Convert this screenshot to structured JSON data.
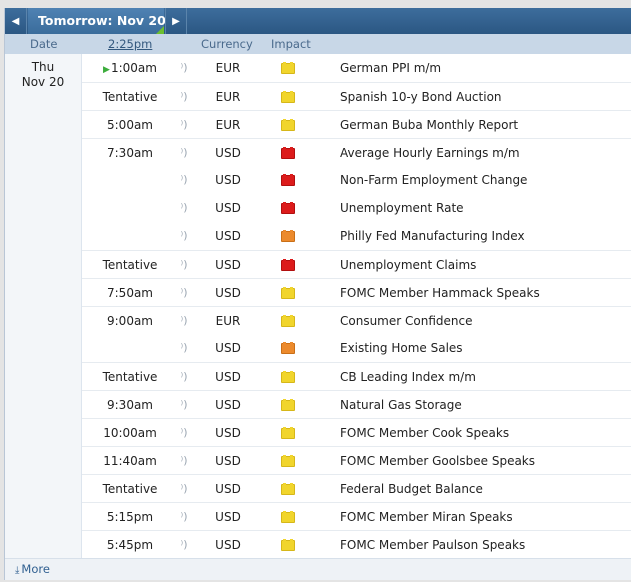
{
  "nav": {
    "prev_icon": "◀",
    "title": "Tomorrow: Nov 20",
    "next_icon": "▶"
  },
  "columns": {
    "date": "Date",
    "time": "2:25pm",
    "currency": "Currency",
    "impact": "Impact"
  },
  "date": {
    "weekday": "Thu",
    "day": "Nov 20"
  },
  "impact_colors": {
    "low": "#f1d52c",
    "medium": "#ec8a2c",
    "high": "#dc1b1b"
  },
  "events": [
    {
      "time": "1:00am",
      "next": true,
      "currency": "EUR",
      "impact": "low",
      "event": "German PPI m/m",
      "group_start": true
    },
    {
      "time": "Tentative",
      "currency": "EUR",
      "impact": "low",
      "event": "Spanish 10-y Bond Auction",
      "group_start": true
    },
    {
      "time": "5:00am",
      "currency": "EUR",
      "impact": "low",
      "event": "German Buba Monthly Report",
      "group_start": true
    },
    {
      "time": "7:30am",
      "currency": "USD",
      "impact": "high",
      "event": "Average Hourly Earnings m/m",
      "group_start": true
    },
    {
      "time": "",
      "currency": "USD",
      "impact": "high",
      "event": "Non-Farm Employment Change",
      "group_start": false
    },
    {
      "time": "",
      "currency": "USD",
      "impact": "high",
      "event": "Unemployment Rate",
      "group_start": false
    },
    {
      "time": "",
      "currency": "USD",
      "impact": "medium",
      "event": "Philly Fed Manufacturing Index",
      "group_start": false
    },
    {
      "time": "Tentative",
      "currency": "USD",
      "impact": "high",
      "event": "Unemployment Claims",
      "group_start": true
    },
    {
      "time": "7:50am",
      "currency": "USD",
      "impact": "low",
      "event": "FOMC Member Hammack Speaks",
      "group_start": true
    },
    {
      "time": "9:00am",
      "currency": "EUR",
      "impact": "low",
      "event": "Consumer Confidence",
      "group_start": true
    },
    {
      "time": "",
      "currency": "USD",
      "impact": "medium",
      "event": "Existing Home Sales",
      "group_start": false
    },
    {
      "time": "Tentative",
      "currency": "USD",
      "impact": "low",
      "event": "CB Leading Index m/m",
      "group_start": true
    },
    {
      "time": "9:30am",
      "currency": "USD",
      "impact": "low",
      "event": "Natural Gas Storage",
      "group_start": true
    },
    {
      "time": "10:00am",
      "currency": "USD",
      "impact": "low",
      "event": "FOMC Member Cook Speaks",
      "group_start": true
    },
    {
      "time": "11:40am",
      "currency": "USD",
      "impact": "low",
      "event": "FOMC Member Goolsbee Speaks",
      "group_start": true
    },
    {
      "time": "Tentative",
      "currency": "USD",
      "impact": "low",
      "event": "Federal Budget Balance",
      "group_start": true
    },
    {
      "time": "5:15pm",
      "currency": "USD",
      "impact": "low",
      "event": "FOMC Member Miran Speaks",
      "group_start": true
    },
    {
      "time": "5:45pm",
      "currency": "USD",
      "impact": "low",
      "event": "FOMC Member Paulson Speaks",
      "group_start": true
    }
  ],
  "footer": {
    "more_label": "More"
  }
}
